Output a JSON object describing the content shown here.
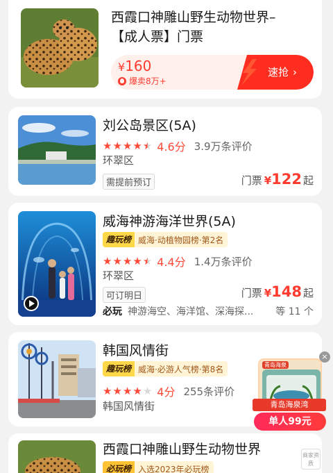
{
  "colors": {
    "accent": "#ff3b30",
    "star": "#ff4a38",
    "rank_bg": "#fff4d6",
    "rank_badge": "#ffd84a"
  },
  "featured": {
    "title_line1": "西霞口神雕山野生动物世界–",
    "title_line2": "【成人票】门票",
    "currency": "¥",
    "price": "160",
    "sold": "爆卖8万+",
    "cta": "速抢"
  },
  "listings": [
    {
      "title": "刘公岛景区(5A)",
      "rating": 4.6,
      "score": "4.6分",
      "reviews": "3.9万条评价",
      "district": "环翠区",
      "tag": "需提前预订",
      "price_label": "门票",
      "currency": "¥",
      "price": "122",
      "price_suffix": "起"
    },
    {
      "title": "威海神游海洋世界(5A)",
      "rank_badge": "趣玩榜",
      "rank_text": "威海·动植物园榜·第2名",
      "rating": 4.4,
      "score": "4.4分",
      "reviews": "1.4万条评价",
      "district": "环翠区",
      "tag": "可订明日",
      "price_label": "门票",
      "currency": "¥",
      "price": "148",
      "price_suffix": "起",
      "must_label": "必玩",
      "must_text": "神游海空、海洋馆、深海探...",
      "must_count": "等 11 个"
    },
    {
      "title": "韩国风情街",
      "rank_badge": "趣玩榜",
      "rank_text": "威海·必游人气榜·第8名",
      "rating": 4,
      "score": "4分",
      "reviews": "255条评价",
      "district": "韩国风情街"
    },
    {
      "title": "西霞口神雕山野生动物世界",
      "rank_badge": "必玩榜",
      "rank_text": "入选2023年必玩榜"
    }
  ],
  "ad": {
    "top_label": "青岛海泉",
    "name": "青岛海泉湾",
    "offer": "单人99元"
  },
  "float": {
    "label": "商家资质"
  }
}
